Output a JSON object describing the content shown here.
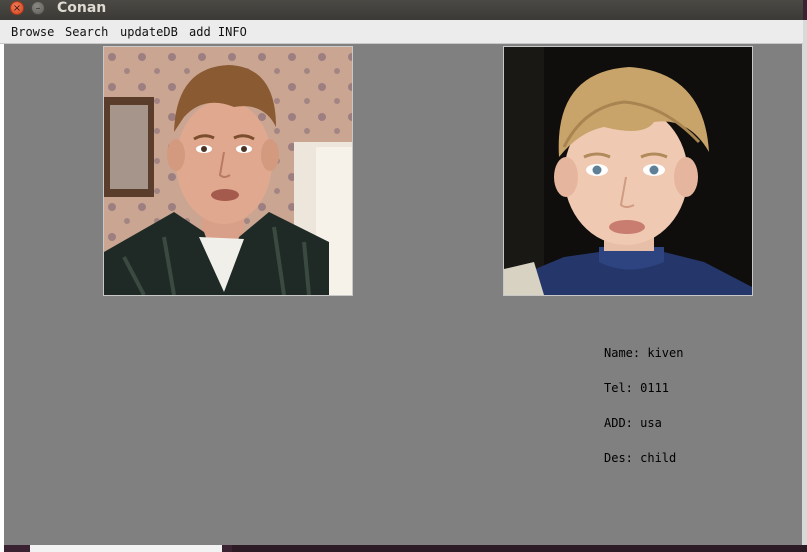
{
  "window": {
    "title": "Conan",
    "close_glyph": "×",
    "minimize_glyph": "–"
  },
  "menu": [
    "Browse",
    "Search",
    "updateDB",
    "add INFO"
  ],
  "photos": [
    {
      "name": "query-photo",
      "description_icon": "adult-face-photo"
    },
    {
      "name": "match-photo",
      "description_icon": "child-face-photo"
    }
  ],
  "info": {
    "name": "Name: kiven",
    "tel": "Tel: 0111",
    "add": "ADD: usa",
    "des": "Des: child"
  },
  "colors": {
    "content_bg": "#808080",
    "menubar_bg": "#ececec",
    "titlebar_bg": "#3e3d39",
    "close_button": "#e05a2b"
  }
}
